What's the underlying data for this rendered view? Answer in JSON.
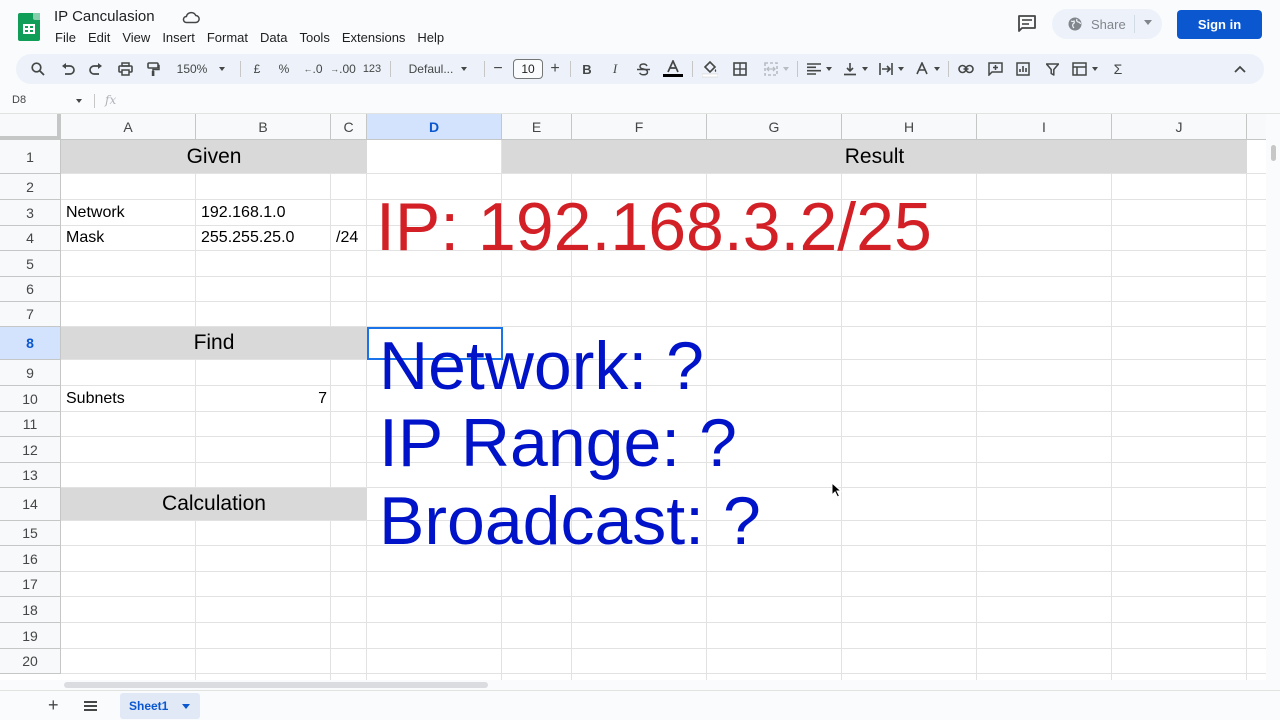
{
  "app": {
    "doc_title": "IP Canculasion",
    "menu": [
      "File",
      "Edit",
      "View",
      "Insert",
      "Format",
      "Data",
      "Tools",
      "Extensions",
      "Help"
    ],
    "share_label": "Share",
    "signin_label": "Sign in"
  },
  "toolbar": {
    "zoom": "150%",
    "currency": "£",
    "percent": "%",
    "decrease_decimal": ".0",
    "increase_decimal": ".00",
    "number_format": "123",
    "font": "Defaul...",
    "font_size": "10",
    "bold": "B",
    "italic": "I",
    "sum": "Σ"
  },
  "formula_bar": {
    "name_box": "D8",
    "fx": "fx",
    "content": ""
  },
  "columns": [
    "A",
    "B",
    "C",
    "D",
    "E",
    "F",
    "G",
    "H",
    "I",
    "J"
  ],
  "selected_column": "D",
  "rows": [
    "1",
    "2",
    "3",
    "4",
    "5",
    "6",
    "7",
    "8",
    "9",
    "10",
    "11",
    "12",
    "13",
    "14",
    "15",
    "16",
    "17",
    "18",
    "19",
    "20"
  ],
  "selected_row": "8",
  "cells": {
    "given_header": "Given",
    "result_header": "Result",
    "network_label": "Network",
    "network_value": "192.168.1.0",
    "mask_label": "Mask",
    "mask_value": "255.255.25.0",
    "mask_cidr": "/24",
    "find_header": "Find",
    "subnets_label": "Subnets",
    "subnets_value": "7",
    "calc_header": "Calculation"
  },
  "overlay": {
    "ip_line": "IP: 192.168.3.2/25",
    "network_line": "Network: ?",
    "range_line": "IP Range: ?",
    "broadcast_line": "Broadcast: ?"
  },
  "sheets": [
    "Sheet1"
  ],
  "colors": {
    "ip_text": "#d32027",
    "question_text": "#0013c8",
    "header_fill": "#d9d9d9",
    "selection": "#1a73e8",
    "signin": "#0b57d0"
  }
}
